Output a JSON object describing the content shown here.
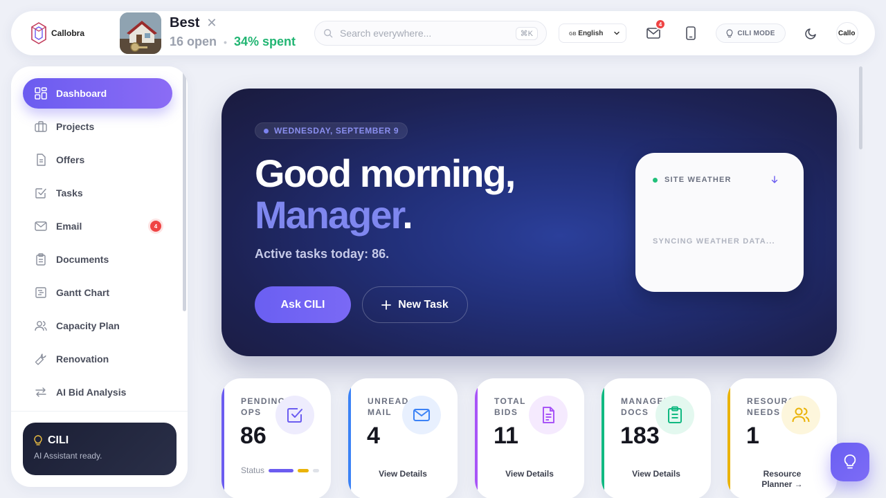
{
  "brand": {
    "logo_text": "Callobra"
  },
  "project": {
    "title": "Best",
    "open_count": "16 open",
    "spent": "34% spent"
  },
  "search": {
    "placeholder": "Search everywhere...",
    "shortcut": "⌘K"
  },
  "language": {
    "selected": "English",
    "flag": "GB"
  },
  "notifications": {
    "mail_count": "4"
  },
  "mode": {
    "label": "CILI MODE"
  },
  "avatar": {
    "label": "Callo"
  },
  "sidebar": {
    "items": [
      {
        "label": "Dashboard",
        "icon": "dashboard-icon",
        "active": true
      },
      {
        "label": "Projects",
        "icon": "briefcase-icon"
      },
      {
        "label": "Offers",
        "icon": "file-icon"
      },
      {
        "label": "Tasks",
        "icon": "checkbox-icon"
      },
      {
        "label": "Email",
        "icon": "mail-icon",
        "badge": "4"
      },
      {
        "label": "Documents",
        "icon": "clipboard-icon"
      },
      {
        "label": "Gantt Chart",
        "icon": "gantt-icon"
      },
      {
        "label": "Capacity Plan",
        "icon": "users-icon"
      },
      {
        "label": "Renovation",
        "icon": "wrench-icon"
      },
      {
        "label": "AI Bid Analysis",
        "icon": "arrows-icon"
      }
    ],
    "assistant": {
      "title": "CILI",
      "subtitle": "AI Assistant ready."
    }
  },
  "hero": {
    "date": "WEDNESDAY, SEPTEMBER 9",
    "greeting_line1": "Good morning,",
    "greeting_name": "Manager",
    "greeting_dot": ".",
    "active_tasks": "Active tasks today: 86.",
    "ask_button": "Ask CILI",
    "new_task_button": "New Task"
  },
  "weather": {
    "title": "SITE WEATHER",
    "status": "SYNCING WEATHER DATA..."
  },
  "stats": [
    {
      "label": "PENDING OPS",
      "value": "86",
      "icon": "checkbox-icon",
      "color": "#6b5cf0",
      "icon_bg": "#eeecfd",
      "footer_label": "Status"
    },
    {
      "label": "UNREAD MAIL",
      "value": "4",
      "icon": "mail-icon",
      "color": "#3b82f6",
      "icon_bg": "#e8f0fe",
      "link": "View Details"
    },
    {
      "label": "TOTAL BIDS",
      "value": "11",
      "icon": "file-icon",
      "color": "#a855f7",
      "icon_bg": "#f5eafe",
      "link": "View Details"
    },
    {
      "label": "MANAGED DOCS",
      "value": "183",
      "icon": "clipboard-icon",
      "color": "#10b981",
      "icon_bg": "#e3f8ef",
      "link": "View Details"
    },
    {
      "label": "RESOURCE NEEDS",
      "value": "1",
      "icon": "users-icon",
      "color": "#eab308",
      "icon_bg": "#fdf6dc",
      "link": "Resource Planner →"
    }
  ],
  "colors": {
    "accent": "#6b5cf0",
    "hero_dark": "#1d2254",
    "success": "#22b573",
    "danger": "#ef4444"
  }
}
